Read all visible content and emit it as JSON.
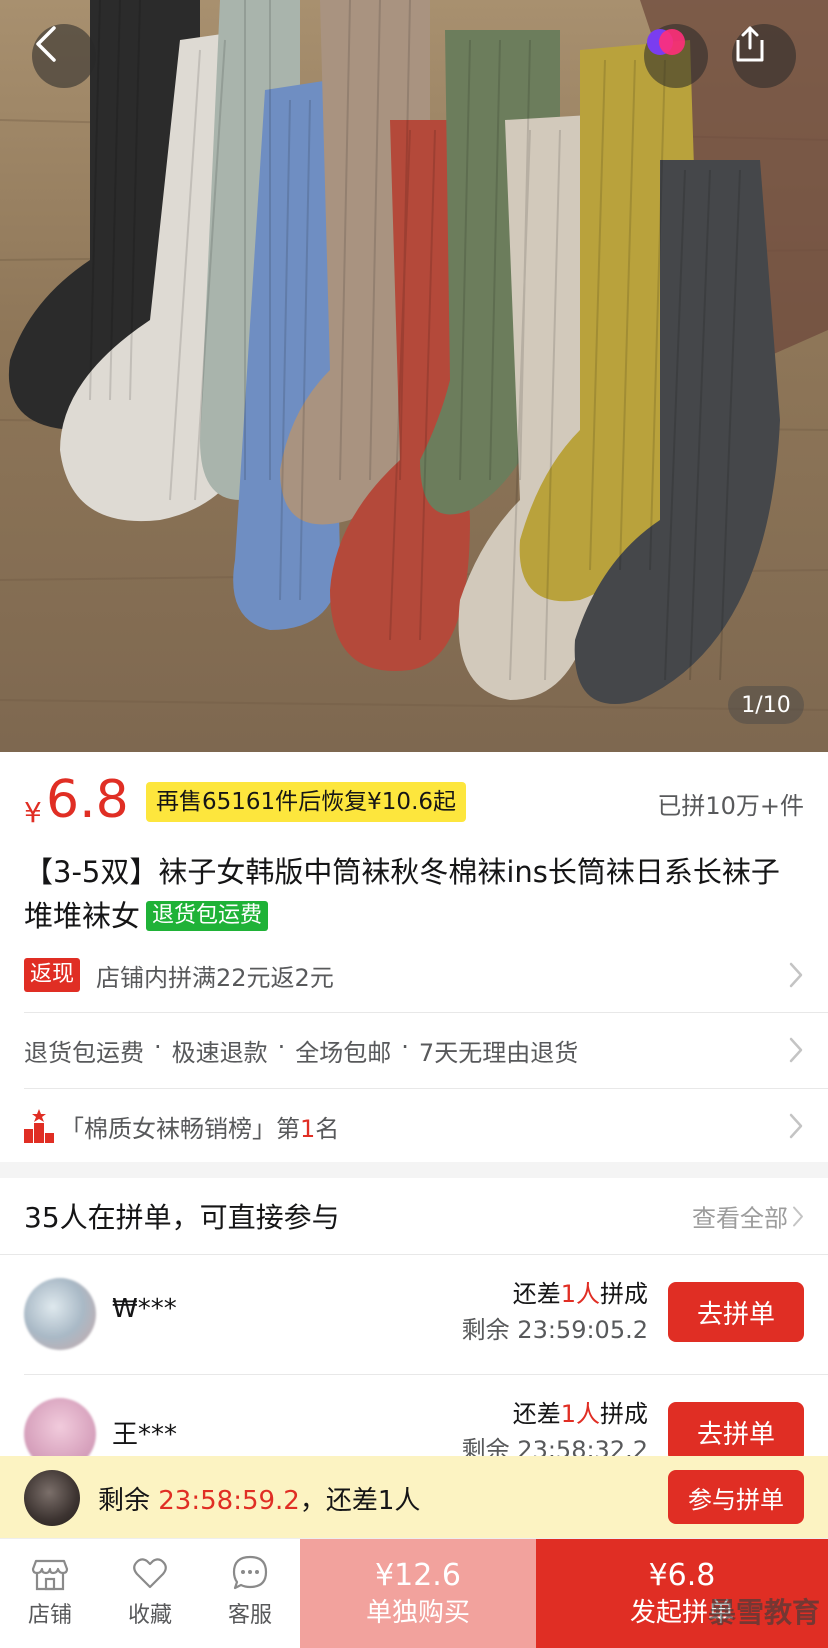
{
  "product_image": {
    "page_indicator": "1/10"
  },
  "price": {
    "currency": "¥",
    "value": "6.8",
    "restore_notice": "再售65161件后恢复¥10.6起",
    "sold": "已拼10万+件"
  },
  "title": {
    "text": "【3-5双】袜子女韩版中筒袜秋冬棉袜ins长筒袜日系长袜子堆堆袜女",
    "tag": "退货包运费"
  },
  "cashback": {
    "badge": "返现",
    "text": "店铺内拼满22元返2元"
  },
  "guarantees": {
    "items": [
      "退货包运费",
      "极速退款",
      "全场包邮",
      "7天无理由退货"
    ],
    "separator": "·"
  },
  "ranking": {
    "prefix": "「棉质女袜畅销榜」第",
    "rank": "1",
    "suffix": "名"
  },
  "group": {
    "title": "35人在拼单，可直接参与",
    "view_all": "查看全部",
    "entries": [
      {
        "name": "₩***",
        "need_prefix": "还差",
        "need_count": "1人",
        "need_suffix": "拼成",
        "remaining": "剩余 23:59:05.2",
        "button": "去拼单"
      },
      {
        "name": "王***",
        "need_prefix": "还差",
        "need_count": "1人",
        "need_suffix": "拼成",
        "remaining": "剩余 23:58:32.2",
        "button": "去拼单"
      }
    ]
  },
  "float_strip": {
    "prefix": "剩余 ",
    "time": "23:58:59.2",
    "suffix": "，还差1人",
    "button": "参与拼单"
  },
  "bottom_bar": {
    "tabs": [
      {
        "label": "店铺",
        "icon": "store-icon"
      },
      {
        "label": "收藏",
        "icon": "heart-icon"
      },
      {
        "label": "客服",
        "icon": "chat-icon"
      }
    ],
    "buy_alone": {
      "price": "¥12.6",
      "label": "单独购买"
    },
    "buy_group": {
      "price": "¥6.8",
      "label": "发起拼单"
    },
    "watermark": "暴雪教育"
  },
  "colors": {
    "accent": "#e02e24",
    "tag_green": "#1fb237",
    "notice_yellow": "#fde63d",
    "strip_bg": "#fcf3c2"
  }
}
